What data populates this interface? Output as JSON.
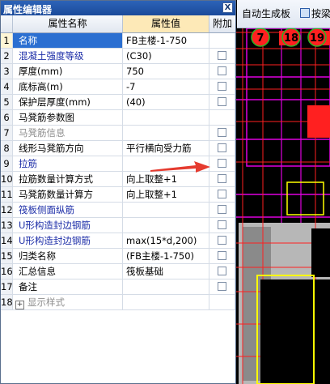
{
  "dialog": {
    "title": "属性编辑器",
    "close_glyph": "X",
    "columns": {
      "name": "属性名称",
      "value": "属性值",
      "add": "附加"
    }
  },
  "toolbar": {
    "auto_generate": "自动生成板",
    "by_beam": "按梁"
  },
  "canvas": {
    "axis_labels": [
      "7",
      "18",
      "19"
    ]
  },
  "properties": [
    {
      "num": "1",
      "name": "名称",
      "value": "FB主楼-1-750",
      "style": "selected",
      "checkbox": false
    },
    {
      "num": "2",
      "name": "混凝土强度等级",
      "value": "(C30)",
      "style": "blue",
      "checkbox": true
    },
    {
      "num": "3",
      "name": "厚度(mm)",
      "value": "750",
      "style": "normal",
      "checkbox": true
    },
    {
      "num": "4",
      "name": "底标高(m)",
      "value": "-7",
      "style": "normal",
      "checkbox": true
    },
    {
      "num": "5",
      "name": "保护层厚度(mm)",
      "value": "(40)",
      "style": "normal",
      "checkbox": true
    },
    {
      "num": "6",
      "name": "马凳筋参数图",
      "value": "",
      "style": "normal",
      "checkbox": false
    },
    {
      "num": "7",
      "name": "马凳筋信息",
      "value": "",
      "style": "gray",
      "checkbox": true
    },
    {
      "num": "8",
      "name": "线形马凳筋方向",
      "value": "平行横向受力筋",
      "style": "normal",
      "checkbox": true
    },
    {
      "num": "9",
      "name": "拉筋",
      "value": "",
      "style": "blue",
      "checkbox": true
    },
    {
      "num": "10",
      "name": "拉筋数量计算方式",
      "value": "向上取整+1",
      "style": "normal",
      "checkbox": true
    },
    {
      "num": "11",
      "name": "马凳筋数量计算方",
      "value": "向上取整+1",
      "style": "normal",
      "checkbox": true
    },
    {
      "num": "12",
      "name": "筏板侧面纵筋",
      "value": "",
      "style": "blue",
      "checkbox": true
    },
    {
      "num": "13",
      "name": "U形构造封边钢筋",
      "value": "",
      "style": "blue",
      "checkbox": true
    },
    {
      "num": "14",
      "name": "U形构造封边钢筋",
      "value": "max(15*d,200)",
      "style": "blue",
      "checkbox": true
    },
    {
      "num": "15",
      "name": "归类名称",
      "value": "(FB主楼-1-750)",
      "style": "normal",
      "checkbox": true
    },
    {
      "num": "16",
      "name": "汇总信息",
      "value": "筏板基础",
      "style": "normal",
      "checkbox": true
    },
    {
      "num": "17",
      "name": "备注",
      "value": "",
      "style": "normal",
      "checkbox": true
    },
    {
      "num": "18",
      "name": "显示样式",
      "value": "",
      "style": "expander",
      "checkbox": false
    }
  ],
  "colors": {
    "title_bar": "#1b4a9a",
    "selection": "#2b6fd1",
    "value_header": "#fde9b7",
    "blue_label": "#1d2ea8",
    "arrow": "#e53b2f",
    "cad_magenta": "#e000e0",
    "cad_red": "#ff2020",
    "cad_yellow": "#ffff00"
  }
}
